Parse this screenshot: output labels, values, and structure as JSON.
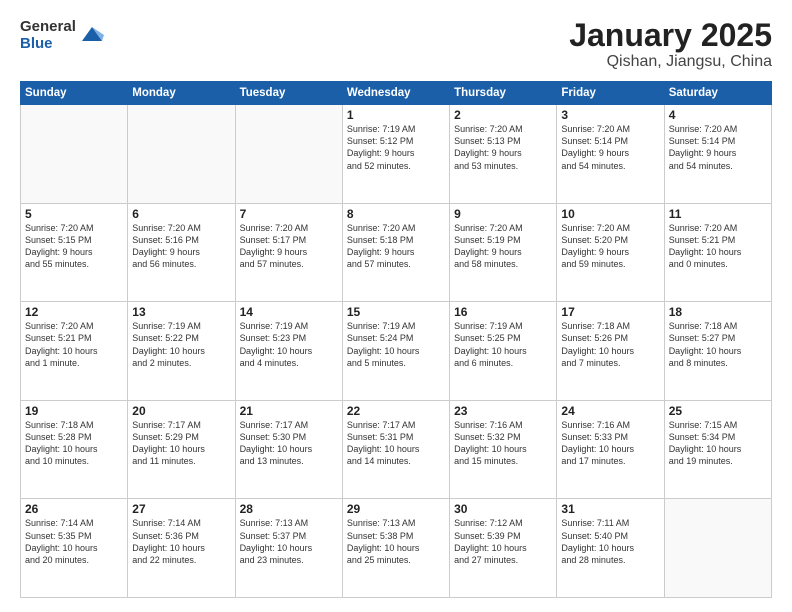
{
  "header": {
    "logo_general": "General",
    "logo_blue": "Blue",
    "month_title": "January 2025",
    "location": "Qishan, Jiangsu, China"
  },
  "days_of_week": [
    "Sunday",
    "Monday",
    "Tuesday",
    "Wednesday",
    "Thursday",
    "Friday",
    "Saturday"
  ],
  "weeks": [
    [
      {
        "day": "",
        "content": ""
      },
      {
        "day": "",
        "content": ""
      },
      {
        "day": "",
        "content": ""
      },
      {
        "day": "1",
        "content": "Sunrise: 7:19 AM\nSunset: 5:12 PM\nDaylight: 9 hours\nand 52 minutes."
      },
      {
        "day": "2",
        "content": "Sunrise: 7:20 AM\nSunset: 5:13 PM\nDaylight: 9 hours\nand 53 minutes."
      },
      {
        "day": "3",
        "content": "Sunrise: 7:20 AM\nSunset: 5:14 PM\nDaylight: 9 hours\nand 54 minutes."
      },
      {
        "day": "4",
        "content": "Sunrise: 7:20 AM\nSunset: 5:14 PM\nDaylight: 9 hours\nand 54 minutes."
      }
    ],
    [
      {
        "day": "5",
        "content": "Sunrise: 7:20 AM\nSunset: 5:15 PM\nDaylight: 9 hours\nand 55 minutes."
      },
      {
        "day": "6",
        "content": "Sunrise: 7:20 AM\nSunset: 5:16 PM\nDaylight: 9 hours\nand 56 minutes."
      },
      {
        "day": "7",
        "content": "Sunrise: 7:20 AM\nSunset: 5:17 PM\nDaylight: 9 hours\nand 57 minutes."
      },
      {
        "day": "8",
        "content": "Sunrise: 7:20 AM\nSunset: 5:18 PM\nDaylight: 9 hours\nand 57 minutes."
      },
      {
        "day": "9",
        "content": "Sunrise: 7:20 AM\nSunset: 5:19 PM\nDaylight: 9 hours\nand 58 minutes."
      },
      {
        "day": "10",
        "content": "Sunrise: 7:20 AM\nSunset: 5:20 PM\nDaylight: 9 hours\nand 59 minutes."
      },
      {
        "day": "11",
        "content": "Sunrise: 7:20 AM\nSunset: 5:21 PM\nDaylight: 10 hours\nand 0 minutes."
      }
    ],
    [
      {
        "day": "12",
        "content": "Sunrise: 7:20 AM\nSunset: 5:21 PM\nDaylight: 10 hours\nand 1 minute."
      },
      {
        "day": "13",
        "content": "Sunrise: 7:19 AM\nSunset: 5:22 PM\nDaylight: 10 hours\nand 2 minutes."
      },
      {
        "day": "14",
        "content": "Sunrise: 7:19 AM\nSunset: 5:23 PM\nDaylight: 10 hours\nand 4 minutes."
      },
      {
        "day": "15",
        "content": "Sunrise: 7:19 AM\nSunset: 5:24 PM\nDaylight: 10 hours\nand 5 minutes."
      },
      {
        "day": "16",
        "content": "Sunrise: 7:19 AM\nSunset: 5:25 PM\nDaylight: 10 hours\nand 6 minutes."
      },
      {
        "day": "17",
        "content": "Sunrise: 7:18 AM\nSunset: 5:26 PM\nDaylight: 10 hours\nand 7 minutes."
      },
      {
        "day": "18",
        "content": "Sunrise: 7:18 AM\nSunset: 5:27 PM\nDaylight: 10 hours\nand 8 minutes."
      }
    ],
    [
      {
        "day": "19",
        "content": "Sunrise: 7:18 AM\nSunset: 5:28 PM\nDaylight: 10 hours\nand 10 minutes."
      },
      {
        "day": "20",
        "content": "Sunrise: 7:17 AM\nSunset: 5:29 PM\nDaylight: 10 hours\nand 11 minutes."
      },
      {
        "day": "21",
        "content": "Sunrise: 7:17 AM\nSunset: 5:30 PM\nDaylight: 10 hours\nand 13 minutes."
      },
      {
        "day": "22",
        "content": "Sunrise: 7:17 AM\nSunset: 5:31 PM\nDaylight: 10 hours\nand 14 minutes."
      },
      {
        "day": "23",
        "content": "Sunrise: 7:16 AM\nSunset: 5:32 PM\nDaylight: 10 hours\nand 15 minutes."
      },
      {
        "day": "24",
        "content": "Sunrise: 7:16 AM\nSunset: 5:33 PM\nDaylight: 10 hours\nand 17 minutes."
      },
      {
        "day": "25",
        "content": "Sunrise: 7:15 AM\nSunset: 5:34 PM\nDaylight: 10 hours\nand 19 minutes."
      }
    ],
    [
      {
        "day": "26",
        "content": "Sunrise: 7:14 AM\nSunset: 5:35 PM\nDaylight: 10 hours\nand 20 minutes."
      },
      {
        "day": "27",
        "content": "Sunrise: 7:14 AM\nSunset: 5:36 PM\nDaylight: 10 hours\nand 22 minutes."
      },
      {
        "day": "28",
        "content": "Sunrise: 7:13 AM\nSunset: 5:37 PM\nDaylight: 10 hours\nand 23 minutes."
      },
      {
        "day": "29",
        "content": "Sunrise: 7:13 AM\nSunset: 5:38 PM\nDaylight: 10 hours\nand 25 minutes."
      },
      {
        "day": "30",
        "content": "Sunrise: 7:12 AM\nSunset: 5:39 PM\nDaylight: 10 hours\nand 27 minutes."
      },
      {
        "day": "31",
        "content": "Sunrise: 7:11 AM\nSunset: 5:40 PM\nDaylight: 10 hours\nand 28 minutes."
      },
      {
        "day": "",
        "content": ""
      }
    ]
  ]
}
